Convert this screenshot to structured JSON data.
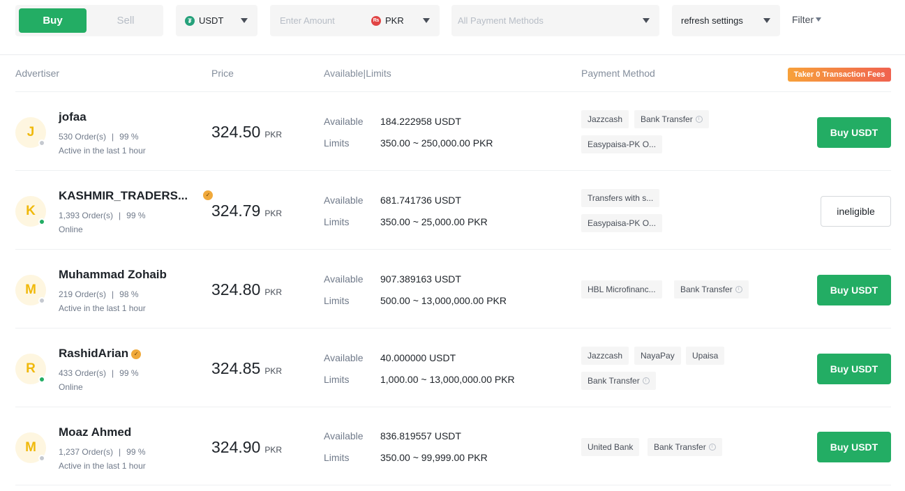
{
  "filters": {
    "buy_label": "Buy",
    "sell_label": "Sell",
    "coin": "USDT",
    "amount_placeholder": "Enter Amount",
    "fiat": "PKR",
    "fiat_icon_text": "₨",
    "coin_icon_text": "₮",
    "payment_placeholder": "All Payment Methods",
    "refresh": "refresh settings",
    "filter_label": "Filter"
  },
  "headers": {
    "advertiser": "Advertiser",
    "price": "Price",
    "available_limits": "Available|Limits",
    "payment_method": "Payment Method",
    "fee_badge": "Taker 0 Transaction Fees"
  },
  "labels": {
    "available": "Available",
    "limits": "Limits",
    "currency": "PKR"
  },
  "rows": [
    {
      "initial": "J",
      "name": "jofaa",
      "verified": false,
      "orders": "530 Order(s)",
      "rate": "99 %",
      "status": "Active in the last 1 hour",
      "online": false,
      "price": "324.50",
      "available": "184.222958 USDT",
      "limits": "350.00 ~ 250,000.00 PKR",
      "payments": [
        "Jazzcash",
        "Bank Transfer",
        "Easypaisa-PK O..."
      ],
      "action": "Buy USDT",
      "eligible": true
    },
    {
      "initial": "K",
      "name": "KASHMIR_TRADERS...",
      "verified": true,
      "orders": "1,393 Order(s)",
      "rate": "99 %",
      "status": "Online",
      "online": true,
      "price": "324.79",
      "available": "681.741736 USDT",
      "limits": "350.00 ~ 25,000.00 PKR",
      "payments": [
        "Transfers with s...",
        "Easypaisa-PK O..."
      ],
      "action": "ineligible",
      "eligible": false
    },
    {
      "initial": "M",
      "name": "Muhammad Zohaib",
      "verified": false,
      "orders": "219 Order(s)",
      "rate": "98 %",
      "status": "Active in the last 1 hour",
      "online": false,
      "price": "324.80",
      "available": "907.389163 USDT",
      "limits": "500.00 ~ 13,000,000.00 PKR",
      "payments": [
        "HBL Microfinanc...",
        "Bank Transfer"
      ],
      "action": "Buy USDT",
      "eligible": true
    },
    {
      "initial": "R",
      "name": "RashidArian",
      "verified": true,
      "orders": "433 Order(s)",
      "rate": "99 %",
      "status": "Online",
      "online": true,
      "price": "324.85",
      "available": "40.000000 USDT",
      "limits": "1,000.00 ~ 13,000,000.00 PKR",
      "payments": [
        "Jazzcash",
        "NayaPay",
        "Upaisa",
        "Bank Transfer"
      ],
      "action": "Buy USDT",
      "eligible": true
    },
    {
      "initial": "M",
      "name": "Moaz Ahmed",
      "verified": false,
      "orders": "1,237 Order(s)",
      "rate": "99 %",
      "status": "Active in the last 1 hour",
      "online": false,
      "price": "324.90",
      "available": "836.819557 USDT",
      "limits": "350.00 ~ 99,999.00 PKR",
      "payments": [
        "United Bank",
        "Bank Transfer"
      ],
      "action": "Buy USDT",
      "eligible": true
    }
  ],
  "colors": {
    "buy_green": "#23ad64",
    "avatar_bg": "#fef6e0",
    "avatar_text": "#f0b90b"
  }
}
